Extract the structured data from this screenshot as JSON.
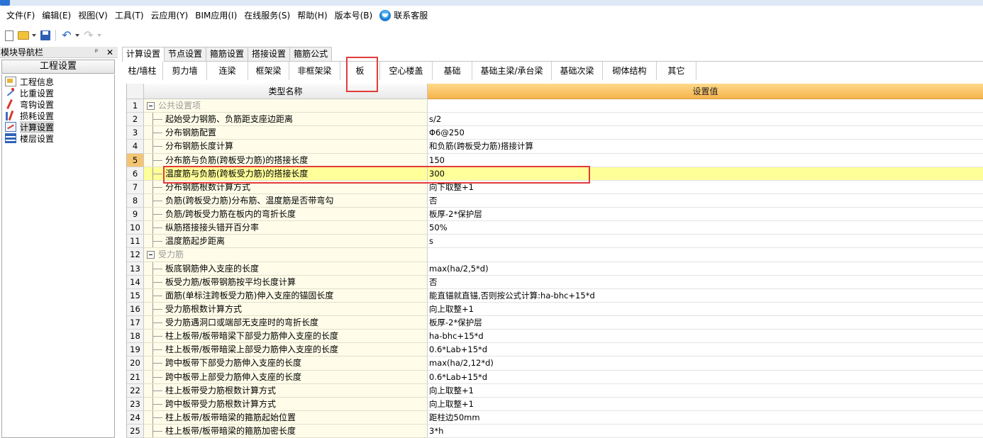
{
  "menu": [
    "文件(F)",
    "编辑(E)",
    "视图(V)",
    "工具(T)",
    "云应用(Y)",
    "BIM应用(I)",
    "在线服务(S)",
    "帮助(H)",
    "版本号(B)"
  ],
  "support_label": "联系客服",
  "nav": {
    "title": "模块导航栏",
    "pin": "ᵖ",
    "close": "✕",
    "section": "工程设置",
    "items": [
      "工程信息",
      "比重设置",
      "弯钩设置",
      "损耗设置",
      "计算设置",
      "楼层设置"
    ]
  },
  "tabs": [
    "计算设置",
    "节点设置",
    "箍筋设置",
    "搭接设置",
    "箍筋公式"
  ],
  "component_tabs": [
    "柱/墙柱",
    "剪力墙",
    "连梁",
    "框架梁",
    "非框架梁",
    "板",
    "空心楼盖",
    "基础",
    "基础主梁/承台梁",
    "基础次梁",
    "砌体结构",
    "其它"
  ],
  "grid": {
    "headers": {
      "name": "类型名称",
      "value": "设置值"
    },
    "rows": [
      {
        "no": "1",
        "name": "公共设置项",
        "value": "",
        "group": true
      },
      {
        "no": "2",
        "name": "起始受力钢筋、负筋距支座边距离",
        "value": "s/2"
      },
      {
        "no": "3",
        "name": "分布钢筋配置",
        "value": "Φ6@250"
      },
      {
        "no": "4",
        "name": "分布钢筋长度计算",
        "value": "和负筋(跨板受力筋)搭接计算"
      },
      {
        "no": "5",
        "name": "分布筋与负筋(跨板受力筋)的搭接长度",
        "value": "150"
      },
      {
        "no": "6",
        "name": "温度筋与负筋(跨板受力筋)的搭接长度",
        "value": "300"
      },
      {
        "no": "7",
        "name": "分布钢筋根数计算方式",
        "value": "向下取整+1"
      },
      {
        "no": "8",
        "name": "负筋(跨板受力筋)分布筋、温度筋是否带弯勾",
        "value": "否"
      },
      {
        "no": "9",
        "name": "负筋/跨板受力筋在板内的弯折长度",
        "value": "板厚-2*保护层"
      },
      {
        "no": "10",
        "name": "纵筋搭接接头错开百分率",
        "value": "50%"
      },
      {
        "no": "11",
        "name": "温度筋起步距离",
        "value": "s"
      },
      {
        "no": "12",
        "name": "受力筋",
        "value": "",
        "group": true
      },
      {
        "no": "13",
        "name": "板底钢筋伸入支座的长度",
        "value": "max(ha/2,5*d)"
      },
      {
        "no": "14",
        "name": "板受力筋/板带钢筋按平均长度计算",
        "value": "否"
      },
      {
        "no": "15",
        "name": "面筋(单标注跨板受力筋)伸入支座的锚固长度",
        "value": "能直锚就直锚,否则按公式计算:ha-bhc+15*d"
      },
      {
        "no": "16",
        "name": "受力筋根数计算方式",
        "value": "向上取整+1"
      },
      {
        "no": "17",
        "name": "受力筋遇洞口或端部无支座时的弯折长度",
        "value": "板厚-2*保护层"
      },
      {
        "no": "18",
        "name": "柱上板带/板带暗梁下部受力筋伸入支座的长度",
        "value": "ha-bhc+15*d"
      },
      {
        "no": "19",
        "name": "柱上板带/板带暗梁上部受力筋伸入支座的长度",
        "value": "0.6*Lab+15*d"
      },
      {
        "no": "20",
        "name": "跨中板带下部受力筋伸入支座的长度",
        "value": "max(ha/2,12*d)"
      },
      {
        "no": "21",
        "name": "跨中板带上部受力筋伸入支座的长度",
        "value": "0.6*Lab+15*d"
      },
      {
        "no": "22",
        "name": "柱上板带受力筋根数计算方式",
        "value": "向上取整+1"
      },
      {
        "no": "23",
        "name": "跨中板带受力筋根数计算方式",
        "value": "向上取整+1"
      },
      {
        "no": "24",
        "name": "柱上板带/板带暗梁的箍筋起始位置",
        "value": "距柱边50mm"
      },
      {
        "no": "25",
        "name": "柱上板带/板带暗梁的箍筋加密长度",
        "value": "3*h"
      }
    ]
  },
  "colors": {
    "accent_header": "#f6b44d",
    "highlight_row": "#ffff99",
    "annotation": "#e23b3b",
    "name_column": "#fffde9"
  }
}
